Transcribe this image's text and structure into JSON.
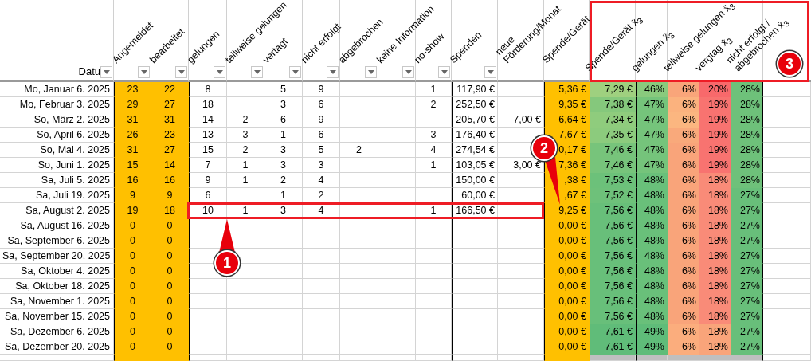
{
  "date_header": {
    "label": "Datu",
    "filter": true
  },
  "columns": [
    {
      "label": "Angemeldet",
      "filter": true
    },
    {
      "label": "bearbeitet",
      "filter": true
    },
    {
      "label": "gelungen",
      "filter": true
    },
    {
      "label": "teilweise gelungen",
      "filter": true
    },
    {
      "label": "vertagt",
      "filter": true
    },
    {
      "label": "nicht erfolgt",
      "filter": true
    },
    {
      "label": "abgebrochen",
      "filter": true
    },
    {
      "label": "keine Information",
      "filter": true
    },
    {
      "label": "no-show",
      "filter": true
    },
    {
      "label": "Spenden",
      "filter": true
    },
    {
      "label": "neue Förderung/Monat",
      "filter": false
    },
    {
      "label": "Spende/Gerät",
      "filter": false
    }
  ],
  "average_columns": [
    {
      "label": "Spende/Gerät x̄$_{3}$"
    },
    {
      "label": "gelungen x̄$_{3}$"
    },
    {
      "label": "teilweise gelungen x̄$_{3}$"
    },
    {
      "label": "vergtag x̄$_{3}$"
    },
    {
      "label": "nicht erfolgt / abgebrochen x̄$_{3}$"
    }
  ],
  "averages_header_highlighted": true,
  "rows": [
    {
      "date": "Mo, Januar 6. 2025",
      "angemeldet": "23",
      "bearbeitet": "22",
      "gelungen": "8",
      "vertagt": "5",
      "nicht_erfolgt": "9",
      "no_show": "1",
      "spenden": "117,90 €",
      "spende_geraet": "5,36 €",
      "avg_spende_geraet": {
        "text": "7,29 €",
        "color": "#9fd07f"
      },
      "avg_gelungen": {
        "text": "46%",
        "color": "#89ca7d"
      },
      "avg_teilweise": {
        "text": "6%",
        "color": "#f9a57a"
      },
      "avg_vertagt": {
        "text": "20%",
        "color": "#f8696b"
      },
      "avg_nicht_erfolgt": {
        "text": "28%",
        "color": "#6ec17a"
      },
      "highlighted": false
    },
    {
      "date": "Mo, Februar 3. 2025",
      "angemeldet": "29",
      "bearbeitet": "27",
      "gelungen": "18",
      "vertagt": "3",
      "nicht_erfolgt": "6",
      "no_show": "2",
      "spenden": "252,50 €",
      "spende_geraet": "9,35 €",
      "avg_spende_geraet": {
        "text": "7,38 €",
        "color": "#85c87c"
      },
      "avg_gelungen": {
        "text": "47%",
        "color": "#75c47b"
      },
      "avg_teilweise": {
        "text": "6%",
        "color": "#fbb27e"
      },
      "avg_vertagt": {
        "text": "19%",
        "color": "#f87370"
      },
      "avg_nicht_erfolgt": {
        "text": "28%",
        "color": "#6ec17a"
      },
      "highlighted": false
    },
    {
      "date": "So, März 2. 2025",
      "angemeldet": "31",
      "bearbeitet": "31",
      "gelungen": "14",
      "teilweise_gelungen": "2",
      "vertagt": "6",
      "nicht_erfolgt": "9",
      "spenden": "205,70 €",
      "neue_foerderung": "7,00 €",
      "spende_geraet": "6,64 €",
      "avg_spende_geraet": {
        "text": "7,34 €",
        "color": "#8fcc7d"
      },
      "avg_gelungen": {
        "text": "47%",
        "color": "#75c47b"
      },
      "avg_teilweise": {
        "text": "6%",
        "color": "#fbb680"
      },
      "avg_vertagt": {
        "text": "19%",
        "color": "#f87370"
      },
      "avg_nicht_erfolgt": {
        "text": "28%",
        "color": "#6ec17a"
      },
      "highlighted": false
    },
    {
      "date": "So, April 6. 2025",
      "angemeldet": "26",
      "bearbeitet": "23",
      "gelungen": "13",
      "teilweise_gelungen": "3",
      "vertagt": "1",
      "nicht_erfolgt": "6",
      "no_show": "3",
      "spenden": "176,40 €",
      "spende_geraet": "7,67 €",
      "avg_spende_geraet": {
        "text": "7,35 €",
        "color": "#8ccb7d"
      },
      "avg_gelungen": {
        "text": "47%",
        "color": "#75c47b"
      },
      "avg_teilweise": {
        "text": "6%",
        "color": "#f9a97b"
      },
      "avg_vertagt": {
        "text": "19%",
        "color": "#f87370"
      },
      "avg_nicht_erfolgt": {
        "text": "28%",
        "color": "#6ec17a"
      },
      "highlighted": false
    },
    {
      "date": "So, Mai 4. 2025",
      "angemeldet": "31",
      "bearbeitet": "27",
      "gelungen": "15",
      "teilweise_gelungen": "2",
      "vertagt": "3",
      "nicht_erfolgt": "5",
      "abgebrochen": "2",
      "no_show": "4",
      "spenden": "274,54 €",
      "spende_geraet": "0,17 €",
      "avg_spende_geraet": {
        "text": "7,46 €",
        "color": "#77c47b"
      },
      "avg_gelungen": {
        "text": "47%",
        "color": "#75c47b"
      },
      "avg_teilweise": {
        "text": "6%",
        "color": "#f9a47a"
      },
      "avg_vertagt": {
        "text": "19%",
        "color": "#f87370"
      },
      "avg_nicht_erfolgt": {
        "text": "28%",
        "color": "#6ec17a"
      },
      "highlighted": false
    },
    {
      "date": "So, Juni 1. 2025",
      "angemeldet": "15",
      "bearbeitet": "14",
      "gelungen": "7",
      "teilweise_gelungen": "1",
      "vertagt": "3",
      "nicht_erfolgt": "3",
      "no_show": "1",
      "spenden": "103,05 €",
      "neue_foerderung": "3,00 €",
      "spende_geraet": "7,36 €",
      "avg_spende_geraet": {
        "text": "7,46 €",
        "color": "#77c47b"
      },
      "avg_gelungen": {
        "text": "47%",
        "color": "#75c47b"
      },
      "avg_teilweise": {
        "text": "6%",
        "color": "#f9a47a"
      },
      "avg_vertagt": {
        "text": "19%",
        "color": "#f87370"
      },
      "avg_nicht_erfolgt": {
        "text": "28%",
        "color": "#6ec17a"
      },
      "highlighted": false
    },
    {
      "date": "Sa, Juli 5. 2025",
      "angemeldet": "16",
      "bearbeitet": "16",
      "gelungen": "9",
      "teilweise_gelungen": "1",
      "vertagt": "2",
      "nicht_erfolgt": "4",
      "spenden": "150,00 €",
      "spende_geraet": ",38 €",
      "avg_spende_geraet": {
        "text": "7,53 €",
        "color": "#6cc17a"
      },
      "avg_gelungen": {
        "text": "48%",
        "color": "#69c07a"
      },
      "avg_teilweise": {
        "text": "6%",
        "color": "#f9a47a"
      },
      "avg_vertagt": {
        "text": "18%",
        "color": "#f98b78"
      },
      "avg_nicht_erfolgt": {
        "text": "28%",
        "color": "#6ec17a"
      },
      "highlighted": false
    },
    {
      "date": "Sa, Juli 19. 2025",
      "angemeldet": "9",
      "bearbeitet": "9",
      "gelungen": "6",
      "vertagt": "1",
      "nicht_erfolgt": "2",
      "spenden": "60,00 €",
      "spende_geraet": ",67 €",
      "avg_spende_geraet": {
        "text": "7,52 €",
        "color": "#6ec17a"
      },
      "avg_gelungen": {
        "text": "48%",
        "color": "#69c07a"
      },
      "avg_teilweise": {
        "text": "6%",
        "color": "#f9a47a"
      },
      "avg_vertagt": {
        "text": "18%",
        "color": "#f98b78"
      },
      "avg_nicht_erfolgt": {
        "text": "27%",
        "color": "#68bf7a"
      },
      "highlighted": false
    },
    {
      "date": "Sa, August 2. 2025",
      "angemeldet": "19",
      "bearbeitet": "18",
      "gelungen": "10",
      "teilweise_gelungen": "1",
      "vertagt": "3",
      "nicht_erfolgt": "4",
      "no_show": "1",
      "spenden": "166,50 €",
      "spende_geraet": "9,25 €",
      "avg_spende_geraet": {
        "text": "7,56 €",
        "color": "#68bf7a"
      },
      "avg_gelungen": {
        "text": "48%",
        "color": "#69c07a"
      },
      "avg_teilweise": {
        "text": "6%",
        "color": "#f9a47a"
      },
      "avg_vertagt": {
        "text": "18%",
        "color": "#f98b78"
      },
      "avg_nicht_erfolgt": {
        "text": "27%",
        "color": "#68bf7a"
      },
      "highlighted": true
    },
    {
      "date": "Sa, August 16. 2025",
      "angemeldet": "0",
      "bearbeitet": "0",
      "spende_geraet": "0,00 €",
      "avg_spende_geraet": {
        "text": "7,56 €",
        "color": "#68bf7a"
      },
      "avg_gelungen": {
        "text": "48%",
        "color": "#69c07a"
      },
      "avg_teilweise": {
        "text": "6%",
        "color": "#f9a47a"
      },
      "avg_vertagt": {
        "text": "18%",
        "color": "#f98b78"
      },
      "avg_nicht_erfolgt": {
        "text": "27%",
        "color": "#68bf7a"
      },
      "highlighted": false
    },
    {
      "date": "Sa, September 6. 2025",
      "angemeldet": "0",
      "bearbeitet": "0",
      "spende_geraet": "0,00 €",
      "avg_spende_geraet": {
        "text": "7,56 €",
        "color": "#68bf7a"
      },
      "avg_gelungen": {
        "text": "48%",
        "color": "#69c07a"
      },
      "avg_teilweise": {
        "text": "6%",
        "color": "#f9a47a"
      },
      "avg_vertagt": {
        "text": "18%",
        "color": "#f98b78"
      },
      "avg_nicht_erfolgt": {
        "text": "27%",
        "color": "#68bf7a"
      },
      "highlighted": false
    },
    {
      "date": "Sa, September 20. 2025",
      "angemeldet": "0",
      "bearbeitet": "0",
      "spende_geraet": "0,00 €",
      "avg_spende_geraet": {
        "text": "7,56 €",
        "color": "#68bf7a"
      },
      "avg_gelungen": {
        "text": "48%",
        "color": "#69c07a"
      },
      "avg_teilweise": {
        "text": "6%",
        "color": "#f9a47a"
      },
      "avg_vertagt": {
        "text": "18%",
        "color": "#f98b78"
      },
      "avg_nicht_erfolgt": {
        "text": "27%",
        "color": "#68bf7a"
      },
      "highlighted": false
    },
    {
      "date": "Sa, Oktober 4. 2025",
      "angemeldet": "0",
      "bearbeitet": "0",
      "spende_geraet": "0,00 €",
      "avg_spende_geraet": {
        "text": "7,56 €",
        "color": "#68bf7a"
      },
      "avg_gelungen": {
        "text": "48%",
        "color": "#69c07a"
      },
      "avg_teilweise": {
        "text": "6%",
        "color": "#f9a47a"
      },
      "avg_vertagt": {
        "text": "18%",
        "color": "#f98b78"
      },
      "avg_nicht_erfolgt": {
        "text": "27%",
        "color": "#68bf7a"
      },
      "highlighted": false
    },
    {
      "date": "Sa, Oktober 18. 2025",
      "angemeldet": "0",
      "bearbeitet": "0",
      "spende_geraet": "0,00 €",
      "avg_spende_geraet": {
        "text": "7,56 €",
        "color": "#68bf7a"
      },
      "avg_gelungen": {
        "text": "48%",
        "color": "#69c07a"
      },
      "avg_teilweise": {
        "text": "6%",
        "color": "#f9a47a"
      },
      "avg_vertagt": {
        "text": "18%",
        "color": "#f98b78"
      },
      "avg_nicht_erfolgt": {
        "text": "27%",
        "color": "#68bf7a"
      },
      "highlighted": false
    },
    {
      "date": "Sa, November 1. 2025",
      "angemeldet": "0",
      "bearbeitet": "0",
      "spende_geraet": "0,00 €",
      "avg_spende_geraet": {
        "text": "7,56 €",
        "color": "#68bf7a"
      },
      "avg_gelungen": {
        "text": "48%",
        "color": "#69c07a"
      },
      "avg_teilweise": {
        "text": "6%",
        "color": "#f9a47a"
      },
      "avg_vertagt": {
        "text": "18%",
        "color": "#f98b78"
      },
      "avg_nicht_erfolgt": {
        "text": "27%",
        "color": "#68bf7a"
      },
      "highlighted": false
    },
    {
      "date": "Sa, November 15. 2025",
      "angemeldet": "0",
      "bearbeitet": "0",
      "spende_geraet": "0,00 €",
      "avg_spende_geraet": {
        "text": "7,56 €",
        "color": "#68bf7a"
      },
      "avg_gelungen": {
        "text": "48%",
        "color": "#69c07a"
      },
      "avg_teilweise": {
        "text": "6%",
        "color": "#f9a47a"
      },
      "avg_vertagt": {
        "text": "18%",
        "color": "#f98b78"
      },
      "avg_nicht_erfolgt": {
        "text": "27%",
        "color": "#68bf7a"
      },
      "highlighted": false
    },
    {
      "date": "Sa, Dezember 6. 2025",
      "angemeldet": "0",
      "bearbeitet": "0",
      "spende_geraet": "0,00 €",
      "avg_spende_geraet": {
        "text": "7,61 €",
        "color": "#60bc79"
      },
      "avg_gelungen": {
        "text": "49%",
        "color": "#5fbc79"
      },
      "avg_teilweise": {
        "text": "6%",
        "color": "#fbad7d"
      },
      "avg_vertagt": {
        "text": "18%",
        "color": "#f9a47a"
      },
      "avg_nicht_erfolgt": {
        "text": "27%",
        "color": "#68bf7a"
      },
      "highlighted": false
    },
    {
      "date": "Sa, Dezember 20. 2025",
      "angemeldet": "0",
      "bearbeitet": "0",
      "spende_geraet": "0,00 €",
      "avg_spende_geraet": {
        "text": "7,61 €",
        "color": "#60bc79"
      },
      "avg_gelungen": {
        "text": "49%",
        "color": "#5fbc79"
      },
      "avg_teilweise": {
        "text": "6%",
        "color": "#fbad7d"
      },
      "avg_vertagt": {
        "text": "18%",
        "color": "#f9a47a"
      },
      "avg_nicht_erfolgt": {
        "text": "27%",
        "color": "#68bf7a"
      },
      "highlighted": false
    }
  ],
  "callouts": [
    {
      "number": "1"
    },
    {
      "number": "2"
    },
    {
      "number": "3"
    }
  ]
}
